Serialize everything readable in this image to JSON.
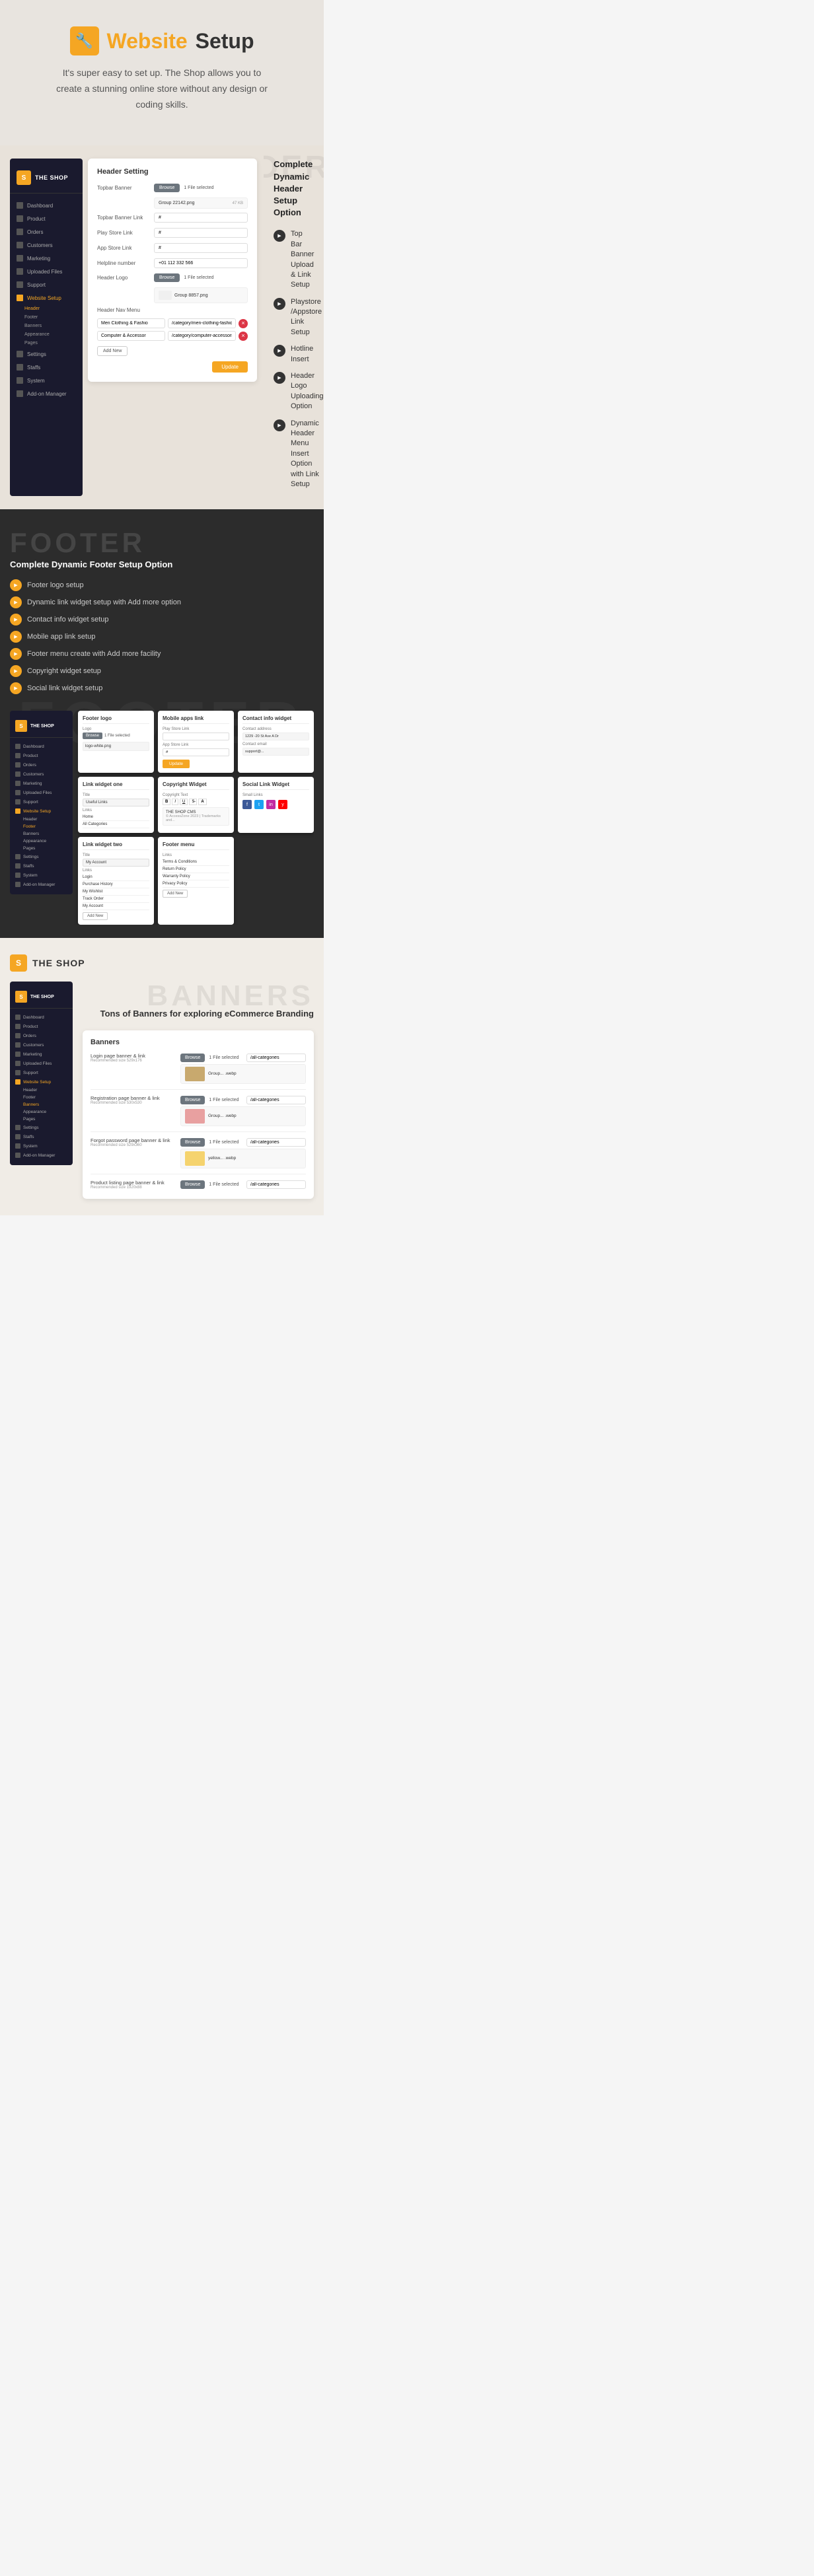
{
  "hero": {
    "icon": "🔧",
    "title_colored": "Website",
    "title_plain": "Setup",
    "subtitle": "It's super easy to set up. The Shop allows you to create a stunning online store without any design or coding skills."
  },
  "header_section": {
    "label": "HEADER",
    "title": "Complete Dynamic Header Setup Option",
    "features": [
      "Top Bar Banner Upload & Link Setup",
      "Playstore /Appstore Link Setup",
      "Hotline Insert",
      "Header Logo Uploading Option",
      "Dynamic Header Menu Insert Option with Link Setup"
    ]
  },
  "form": {
    "title": "Header Setting",
    "topbar_banner_label": "Topbar Banner",
    "browse_label": "Browse",
    "file_selected": "1 File selected",
    "file_preview": "Group 22142.png",
    "topbar_link_label": "Topbar Banner Link",
    "topbar_link_val": "#",
    "playstore_label": "Play Store Link",
    "playstore_val": "#",
    "appstore_label": "App Store Link",
    "appstore_val": "#",
    "hotline_label": "Helpline number",
    "hotline_val": "+01 112 332 566",
    "header_logo_label": "Header Logo",
    "logo_file_preview": "Group 8857.png",
    "header_nav_label": "Header Nav Menu",
    "nav_items": [
      {
        "label": "Men Clothing & Fashio",
        "link": "/category/men-clothing-fashion"
      },
      {
        "label": "Computer & Accessor",
        "link": "/category/computer-accessories"
      }
    ],
    "add_new_label": "Add New",
    "update_label": "Update"
  },
  "sidebar": {
    "logo": "THE SHOP",
    "items": [
      {
        "label": "Dashboard",
        "active": false
      },
      {
        "label": "Product",
        "active": false
      },
      {
        "label": "Orders",
        "active": false
      },
      {
        "label": "Customers",
        "active": false
      },
      {
        "label": "Marketing",
        "active": false
      },
      {
        "label": "Uploaded Files",
        "active": false
      },
      {
        "label": "Support",
        "active": false
      },
      {
        "label": "Website Setup",
        "active": true
      }
    ],
    "sub_items": [
      {
        "label": "Header",
        "active": true
      },
      {
        "label": "Footer",
        "active": false
      },
      {
        "label": "Banners",
        "active": false
      },
      {
        "label": "Appearance",
        "active": false
      },
      {
        "label": "Pages",
        "active": false
      }
    ],
    "bottom_items": [
      {
        "label": "Settings",
        "active": false
      },
      {
        "label": "Staffs",
        "active": false
      },
      {
        "label": "System",
        "active": false
      },
      {
        "label": "Add-on Manager",
        "active": false
      }
    ]
  },
  "footer_section": {
    "big_label": "FOOTER",
    "title": "Complete Dynamic Footer Setup Option",
    "features": [
      "Footer logo setup",
      "Dynamic link widget setup with Add more option",
      "Contact info widget setup",
      "Mobile app link setup",
      "Footer menu create with Add more facility",
      "Copyright widget setup",
      "Social link widget setup"
    ],
    "footer_logo_label": "Footer logo",
    "logo_input_label": "Logo",
    "footer_cards": {
      "link_widget_one": {
        "title": "Link widget one",
        "title_label": "Title",
        "title_val": "Useful Links",
        "links_label": "Links",
        "link_items": [
          "Home",
          "All Categories"
        ]
      },
      "link_widget_two": {
        "title": "Link widget two",
        "title_label": "Title",
        "title_val": "My Account",
        "links_label": "Links",
        "link_items": [
          "Login",
          "Purchase History",
          "My Wishlist",
          "Track Order",
          "My Account"
        ]
      },
      "contact_info": {
        "title": "Contact info widget",
        "address_label": "Contact address",
        "address_val": "1229 -20 St Ave A Dr",
        "email_label": "Contact email",
        "email_val": "support@..."
      },
      "mobile_apps": {
        "title": "Mobile apps link",
        "playstore_label": "Play Store Link",
        "appstore_label": "App Store Link",
        "update_btn": "Update"
      },
      "copyright": {
        "title": "Copyright Widget",
        "text_label": "Copyright Text",
        "text_val": "THE SHOP CMS",
        "sub_text": "© AccessZone 2023 | Trademarks and..."
      },
      "footer_menu": {
        "title": "Footer menu",
        "link_items": [
          "Terms & Conditions",
          "Return Policy",
          "Warranty Policy",
          "Privacy Policy"
        ]
      },
      "social_links": {
        "title": "Social Link Widget",
        "small_links_label": "Small Links"
      }
    }
  },
  "banners_section": {
    "big_title": "BANNERS",
    "subtitle": "Tons of Banners for exploring eCommerce Branding",
    "form_title": "Banners",
    "banner_items": [
      {
        "label": "Login page banner & link",
        "sub_label": "Recommended size 529x176",
        "file": "Group... .webp",
        "input_val": "/all-categories"
      },
      {
        "label": "Registration page banner & link",
        "sub_label": "Recommended size 530x530",
        "file": "Group... .webp",
        "input_val": "/all-categories"
      },
      {
        "label": "Forgot password page banner & link",
        "sub_label": "Recommended size 529x360",
        "file": "yellow... .webp",
        "input_val": "/all-categories"
      },
      {
        "label": "Product listing page banner & link",
        "sub_label": "Recommended size 1920x88",
        "file": "",
        "input_val": "/all-categories"
      }
    ]
  }
}
